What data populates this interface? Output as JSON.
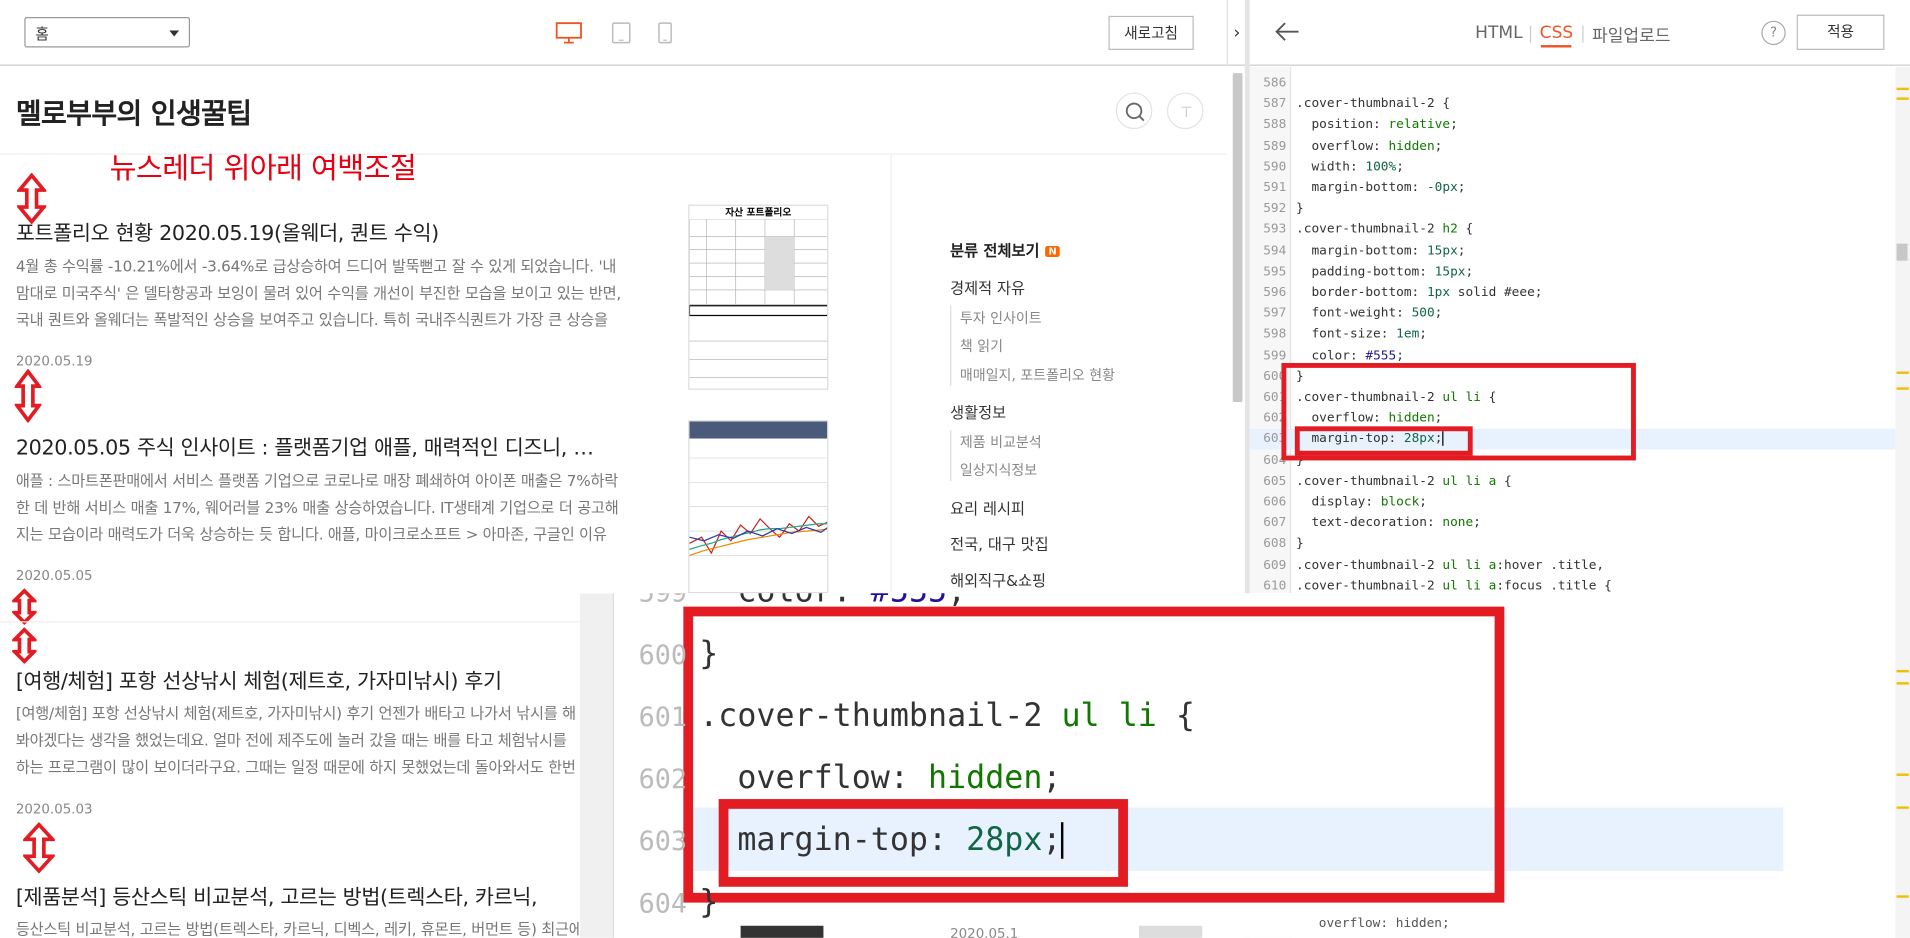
{
  "toolbar": {
    "page_select": "홈",
    "refresh_label": "새로고침",
    "collapse_label": "›"
  },
  "blog": {
    "title": "멜로부부의 인생꿀팁",
    "annotation": "뉴스레더 위아래 여백조절",
    "posts": [
      {
        "title": "포트폴리오 현황 2020.05.19(올웨더, 퀀트 수익)",
        "excerpt": "4월 총 수익률 -10.21%에서 -3.64%로 급상승하여 드디어 발뚝뻗고 잘 수 있게 되었습니다. '내맘대로 미국주식' 은 델타항공과 보잉이 물려 있어 수익를 개선이 부진한 모습을 보이고 있는 반면, 국내 퀀트와 올웨더는 폭발적인 상승을 보여주고 있습니다. 특히 국내주식퀀트가 가장 큰 상승을 …",
        "date": "2020.05.19",
        "thumb_title": "자산 포트폴리오"
      },
      {
        "title": "2020.05.05 주식 인사이트 : 플랫폼기업 애플, 매력적인 디즈니, …",
        "excerpt": "애플 : 스마트폰판매에서 서비스 플랫폼 기업으로 코로나로 매장 폐쇄하여 아이폰 매출은 7%하락한 데 반해 서비스 매출 17%, 웨어러블 23% 매출 상승하였습니다. IT생태계 기업으로 더 공고해지는 모습이라 매력도가 더욱 상승하는 듯 합니다. 애플, 마이크로소프트 > 아마존, 구글인 이유 :…",
        "date": "2020.05.05"
      },
      {
        "title": "[여행/체험] 포항 선상낚시 체험(제트호, 가자미낚시) 후기",
        "excerpt": "[여행/체험] 포항 선상낚시 체험(제트호, 가자미낚시) 후기 언젠가 배타고 나가서 낚시를 해봐야겠다는 생각을 했었는데요. 얼마 전에 제주도에 놀러 갔을 때는 배를 타고 체험낚시를 하는 프로그램이 많이 보이더라구요. 그때는 일정 때문에 하지 못했었는데 돌아와서도 한번씩 선상낚시를",
        "date": "2020.05.03"
      },
      {
        "title": "[제품분석] 등산스틱 비교분석, 고르는 방법(트렉스타, 카르닉,",
        "excerpt": "등산스틱 비교분석, 고르는 방법(트렉스타, 카르닉, 디벡스, 레키, 휴몬트, 버먼트 등) 최근에 등산",
        "date": ""
      }
    ],
    "sidebar": {
      "all_label": "분류 전체보기",
      "new_badge": "N",
      "categories": [
        {
          "label": "경제적 자유",
          "subs": [
            "투자 인사이트",
            "책 읽기",
            "매매일지, 포트폴리오 현황"
          ]
        },
        {
          "label": "생활정보",
          "subs": [
            "제품 비교분석",
            "일상지식정보"
          ]
        },
        {
          "label": "요리 레시피",
          "subs": []
        },
        {
          "label": "전국, 대구 맛집",
          "subs": []
        },
        {
          "label": "해외직구&쇼핑",
          "subs": []
        }
      ],
      "bottom_date": "2020.05.1"
    }
  },
  "editor": {
    "tabs": [
      "HTML",
      "CSS",
      "파일업로드"
    ],
    "active_tab": "CSS",
    "help_label": "?",
    "apply_label": "적용",
    "lines": [
      {
        "n": "586",
        "t": ""
      },
      {
        "n": "587",
        "t": ".cover-thumbnail-2 {"
      },
      {
        "n": "588",
        "t": "  position: relative;"
      },
      {
        "n": "589",
        "t": "  overflow: hidden;"
      },
      {
        "n": "590",
        "t": "  width: 100%;"
      },
      {
        "n": "591",
        "t": "  margin-bottom: -0px;"
      },
      {
        "n": "592",
        "t": "}"
      },
      {
        "n": "593",
        "t": ".cover-thumbnail-2 h2 {"
      },
      {
        "n": "594",
        "t": "  margin-bottom: 15px;"
      },
      {
        "n": "595",
        "t": "  padding-bottom: 15px;"
      },
      {
        "n": "596",
        "t": "  border-bottom: 1px solid #eee;"
      },
      {
        "n": "597",
        "t": "  font-weight: 500;"
      },
      {
        "n": "598",
        "t": "  font-size: 1em;"
      },
      {
        "n": "599",
        "t": "  color: #555;"
      },
      {
        "n": "600",
        "t": "}"
      },
      {
        "n": "601",
        "t": ".cover-thumbnail-2 ul li {"
      },
      {
        "n": "602",
        "t": "  overflow: hidden;"
      },
      {
        "n": "603",
        "t": "  margin-top: 28px;"
      },
      {
        "n": "604",
        "t": "}"
      },
      {
        "n": "605",
        "t": ".cover-thumbnail-2 ul li a {"
      },
      {
        "n": "606",
        "t": "  display: block;"
      },
      {
        "n": "607",
        "t": "  text-decoration: none;"
      },
      {
        "n": "608",
        "t": "}"
      },
      {
        "n": "609",
        "t": ".cover-thumbnail-2 ul li a:hover .title,"
      },
      {
        "n": "610",
        "t": ".cover-thumbnail-2 ul li a:focus .title {"
      }
    ]
  },
  "zoom": {
    "lines": [
      {
        "n": "599",
        "t": "  color: #555;"
      },
      {
        "n": "600",
        "t": "}"
      },
      {
        "n": "601",
        "t": ".cover-thumbnail-2 ul li {"
      },
      {
        "n": "602",
        "t": "  overflow: hidden;"
      },
      {
        "n": "603",
        "t": "  margin-top: 28px;"
      },
      {
        "n": "604",
        "t": "}"
      }
    ],
    "bottom_code": "  overflow: hidden;"
  }
}
